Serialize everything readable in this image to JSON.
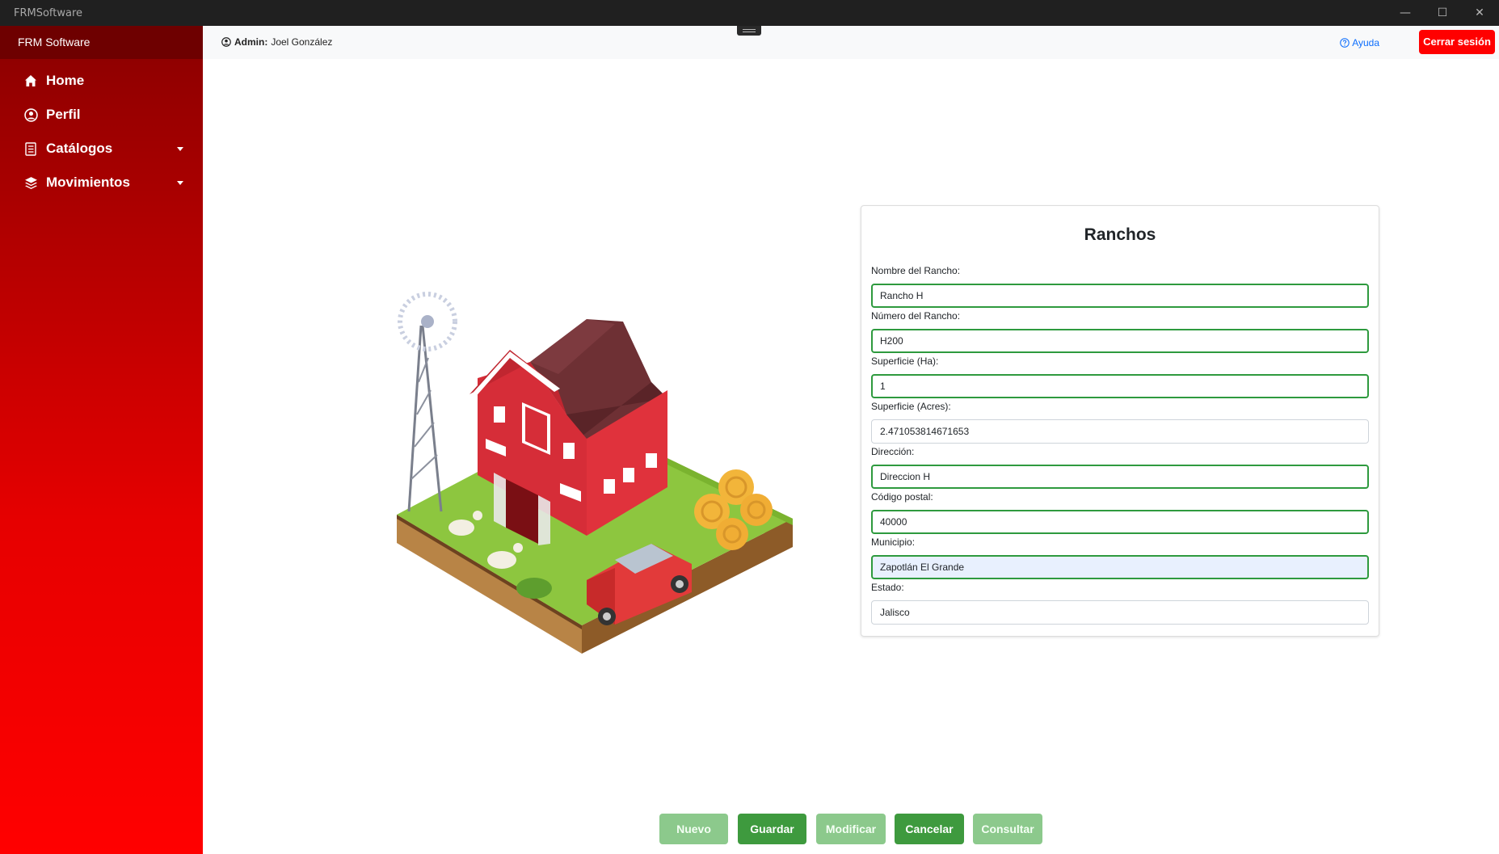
{
  "window": {
    "title": "FRMSoftware",
    "controls": {
      "minimize": "—",
      "maximize": "☐",
      "close": "✕"
    }
  },
  "sidebar": {
    "brand": "FRM Software",
    "items": [
      {
        "label": "Home",
        "icon": "home-icon"
      },
      {
        "label": "Perfil",
        "icon": "user-circle-icon"
      },
      {
        "label": "Catálogos",
        "icon": "catalog-icon",
        "has_dropdown": true
      },
      {
        "label": "Movimientos",
        "icon": "layers-icon",
        "has_dropdown": true
      }
    ]
  },
  "header": {
    "admin_label": "Admin:",
    "admin_name": "Joel González",
    "help_label": "Ayuda",
    "logout_label": "Cerrar sesión"
  },
  "form": {
    "title": "Ranchos",
    "fields": [
      {
        "label": "Nombre del Rancho:",
        "value": "Rancho H"
      },
      {
        "label": "Número del Rancho:",
        "value": "H200"
      },
      {
        "label": "Superficie (Ha):",
        "value": "1"
      },
      {
        "label": "Superficie (Acres):",
        "value": "2.471053814671653"
      },
      {
        "label": "Dirección:",
        "value": "Direccion H"
      },
      {
        "label": "Código postal:",
        "value": "40000"
      },
      {
        "label": "Municipio:",
        "value": "Zapotlán El Grande"
      },
      {
        "label": "Estado:",
        "value": "Jalisco"
      }
    ]
  },
  "actions": {
    "nuevo": "Nuevo",
    "guardar": "Guardar",
    "modificar": "Modificar",
    "cancelar": "Cancelar",
    "consultar": "Consultar"
  },
  "colors": {
    "accent_red": "#ff0000",
    "field_border_valid": "#2e9a3e",
    "button_green": "#3e9a3e",
    "button_green_disabled": "#8cc98c"
  }
}
